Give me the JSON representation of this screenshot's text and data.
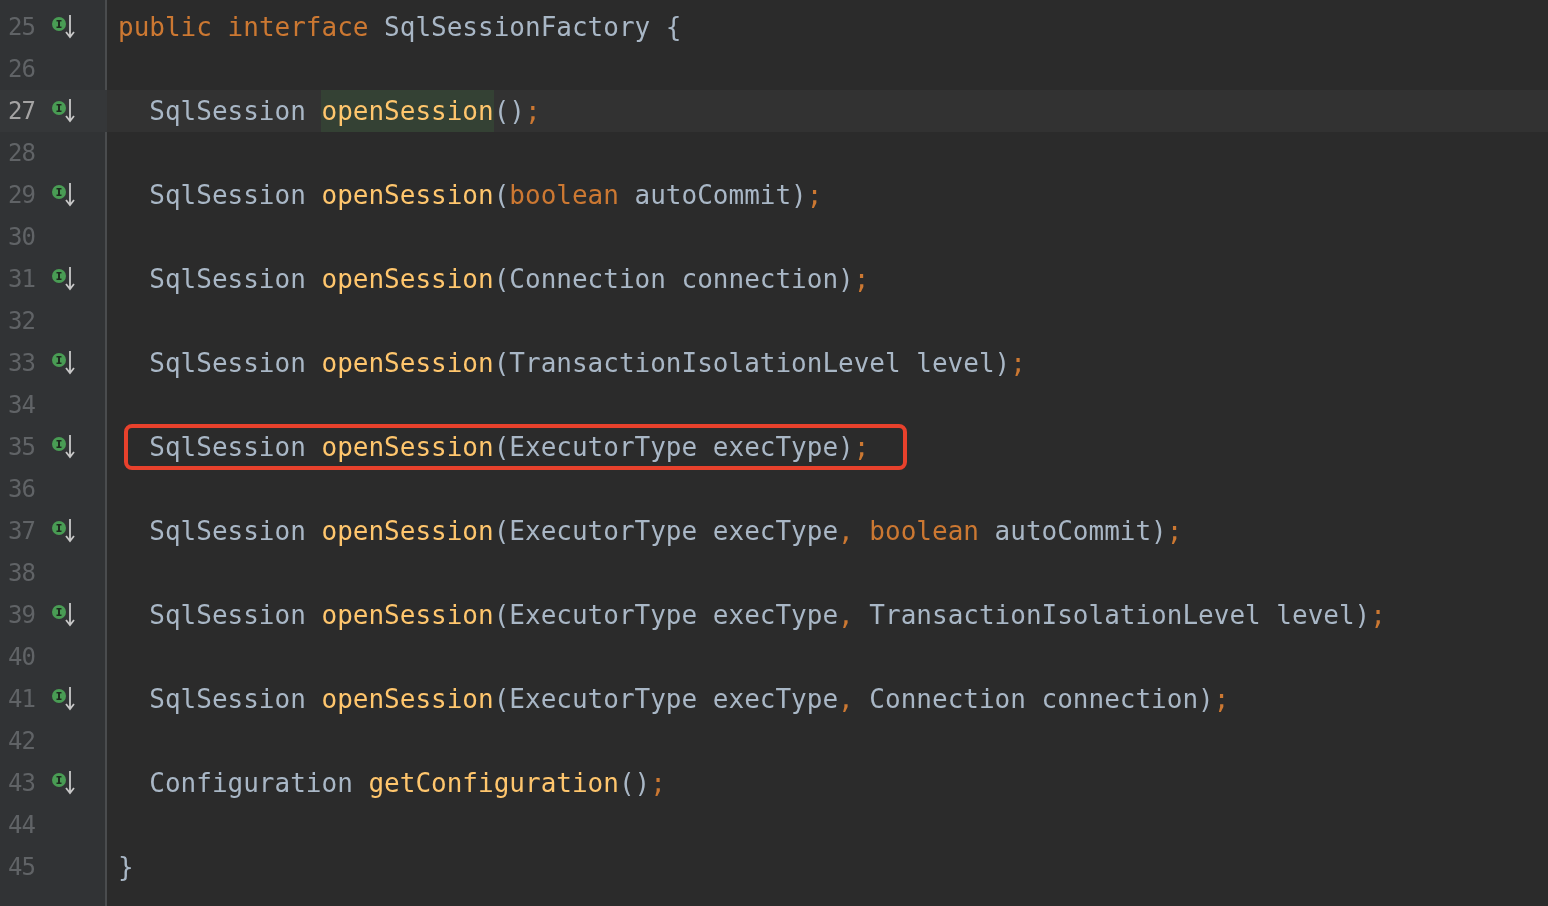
{
  "editor": {
    "lines": [
      {
        "number": "25",
        "gutter_icon": true,
        "current": false,
        "boxed": false,
        "tokens": [
          {
            "text": "public interface",
            "kind": "keyword"
          },
          {
            "text": " SqlSessionFactory {",
            "kind": "plain"
          }
        ],
        "children": [
          {
            "number": "26",
            "gutter_icon": false,
            "current": false
          },
          {
            "number": "27",
            "gutter_icon": true,
            "current": true,
            "boxed": false,
            "tokens": [
              {
                "text": "SqlSession ",
                "kind": "plain"
              },
              {
                "text": "openSession",
                "kind": "method",
                "highlighted": true
              },
              {
                "text": "()",
                "kind": "plain"
              },
              {
                "text": ";",
                "kind": "keyword"
              }
            ]
          },
          {
            "number": "28",
            "gutter_icon": false,
            "current": false
          },
          {
            "number": "29",
            "gutter_icon": true,
            "current": false,
            "boxed": false,
            "tokens": [
              {
                "text": "SqlSession ",
                "kind": "plain"
              },
              {
                "text": "openSession",
                "kind": "method"
              },
              {
                "text": "(",
                "kind": "plain"
              },
              {
                "text": "boolean",
                "kind": "keyword"
              },
              {
                "text": " autoCommit)",
                "kind": "plain"
              },
              {
                "text": ";",
                "kind": "keyword"
              }
            ]
          },
          {
            "number": "30",
            "gutter_icon": false,
            "current": false
          },
          {
            "number": "31",
            "gutter_icon": true,
            "current": false,
            "boxed": false,
            "tokens": [
              {
                "text": "SqlSession ",
                "kind": "plain"
              },
              {
                "text": "openSession",
                "kind": "method"
              },
              {
                "text": "(Connection connection)",
                "kind": "plain"
              },
              {
                "text": ";",
                "kind": "keyword"
              }
            ]
          },
          {
            "number": "32",
            "gutter_icon": false,
            "current": false
          },
          {
            "number": "33",
            "gutter_icon": true,
            "current": false,
            "boxed": false,
            "tokens": [
              {
                "text": "SqlSession ",
                "kind": "plain"
              },
              {
                "text": "openSession",
                "kind": "method"
              },
              {
                "text": "(TransactionIsolationLevel level)",
                "kind": "plain"
              },
              {
                "text": ";",
                "kind": "keyword"
              }
            ]
          },
          {
            "number": "34",
            "gutter_icon": false,
            "current": false
          },
          {
            "number": "35",
            "gutter_icon": true,
            "current": false,
            "boxed": true,
            "tokens": [
              {
                "text": "SqlSession ",
                "kind": "plain"
              },
              {
                "text": "openSession",
                "kind": "method"
              },
              {
                "text": "(ExecutorType execType)",
                "kind": "plain"
              },
              {
                "text": ";",
                "kind": "keyword"
              }
            ]
          },
          {
            "number": "36",
            "gutter_icon": false,
            "current": false
          },
          {
            "number": "37",
            "gutter_icon": true,
            "current": false,
            "boxed": false,
            "tokens": [
              {
                "text": "SqlSession ",
                "kind": "plain"
              },
              {
                "text": "openSession",
                "kind": "method"
              },
              {
                "text": "(ExecutorType execType",
                "kind": "plain"
              },
              {
                "text": ", ",
                "kind": "keyword"
              },
              {
                "text": "boolean",
                "kind": "keyword"
              },
              {
                "text": " autoCommit)",
                "kind": "plain"
              },
              {
                "text": ";",
                "kind": "keyword"
              }
            ]
          },
          {
            "number": "38",
            "gutter_icon": false,
            "current": false
          },
          {
            "number": "39",
            "gutter_icon": true,
            "current": false,
            "boxed": false,
            "tokens": [
              {
                "text": "SqlSession ",
                "kind": "plain"
              },
              {
                "text": "openSession",
                "kind": "method"
              },
              {
                "text": "(ExecutorType execType",
                "kind": "plain"
              },
              {
                "text": ", ",
                "kind": "keyword"
              },
              {
                "text": "TransactionIsolationLevel level)",
                "kind": "plain"
              },
              {
                "text": ";",
                "kind": "keyword"
              }
            ]
          },
          {
            "number": "40",
            "gutter_icon": false,
            "current": false
          },
          {
            "number": "41",
            "gutter_icon": true,
            "current": false,
            "boxed": false,
            "tokens": [
              {
                "text": "SqlSession ",
                "kind": "plain"
              },
              {
                "text": "openSession",
                "kind": "method"
              },
              {
                "text": "(ExecutorType execType",
                "kind": "plain"
              },
              {
                "text": ", ",
                "kind": "keyword"
              },
              {
                "text": "Connection connection)",
                "kind": "plain"
              },
              {
                "text": ";",
                "kind": "keyword"
              }
            ]
          },
          {
            "number": "42",
            "gutter_icon": false,
            "current": false
          },
          {
            "number": "43",
            "gutter_icon": true,
            "current": false,
            "boxed": false,
            "tokens": [
              {
                "text": "Configuration ",
                "kind": "plain"
              },
              {
                "text": "getConfiguration",
                "kind": "method"
              },
              {
                "text": "()",
                "kind": "plain"
              },
              {
                "text": ";",
                "kind": "keyword"
              }
            ]
          },
          {
            "number": "44",
            "gutter_icon": false,
            "current": false
          }
        ]
      },
      {
        "number": "45",
        "gutter_icon": false,
        "current": false,
        "boxed": false,
        "tokens": [
          {
            "text": "}",
            "kind": "plain"
          }
        ]
      }
    ]
  }
}
